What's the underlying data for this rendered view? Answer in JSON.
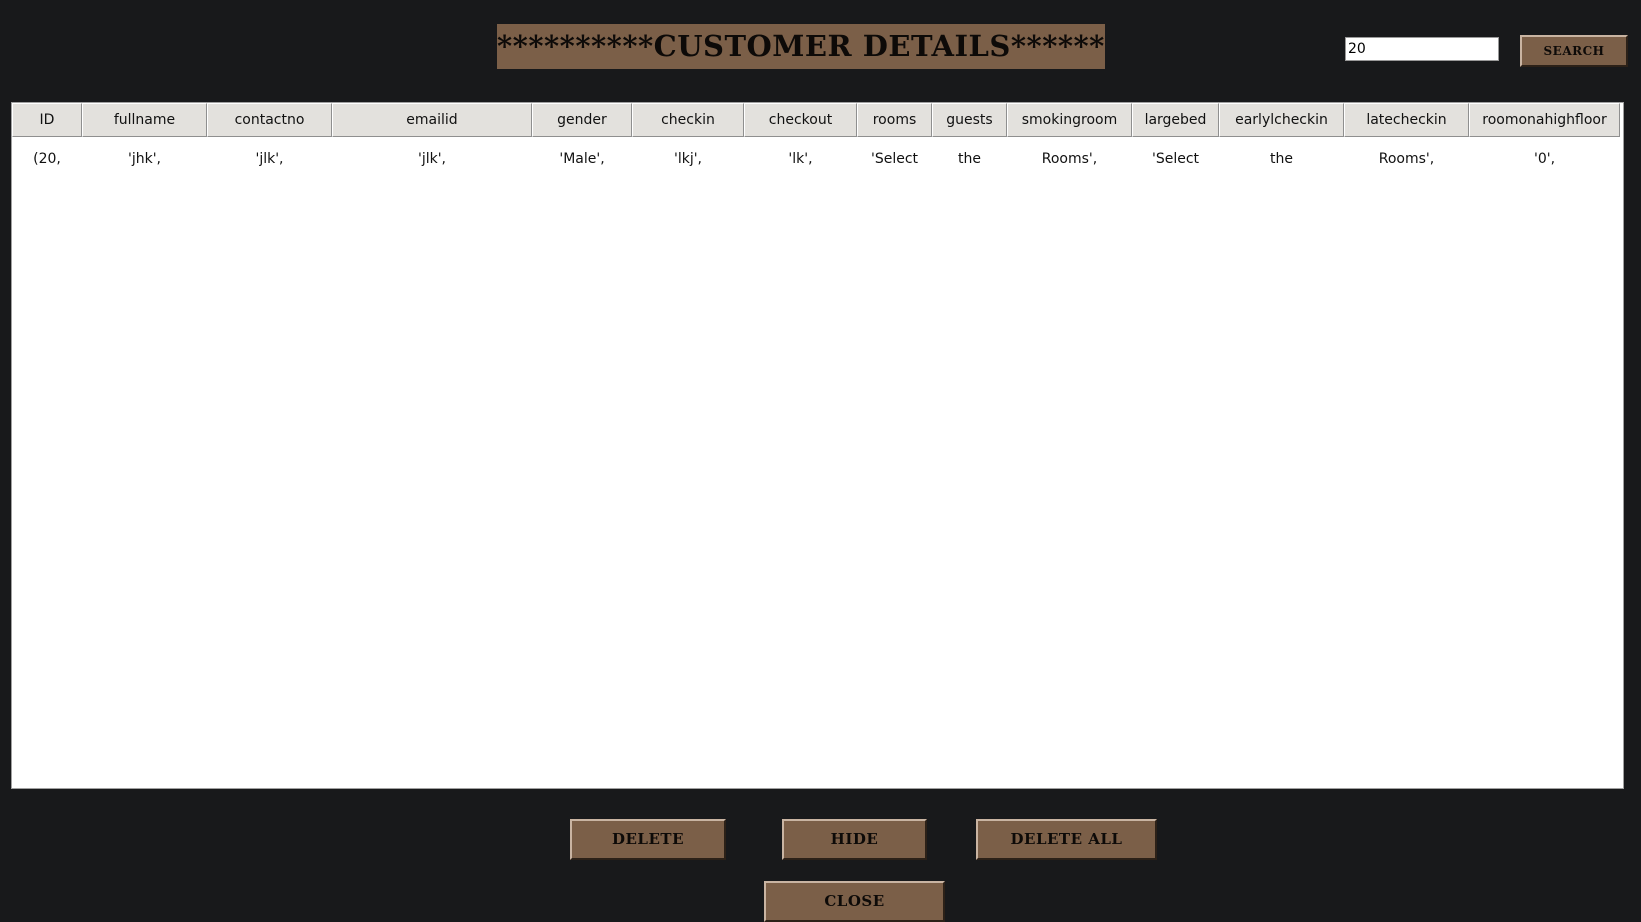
{
  "title": "**********CUSTOMER DETAILS**********",
  "search": {
    "value": "20",
    "button_label": "SEARCH"
  },
  "table": {
    "columns": [
      "ID",
      "fullname",
      "contactno",
      "emailid",
      "gender",
      "checkin",
      "checkout",
      "rooms",
      "guests",
      "smokingroom",
      "largebed",
      "earlylcheckin",
      "latecheckin",
      "roomonahighfloor"
    ],
    "rows": [
      [
        "(20,",
        "'jhk',",
        "'jlk',",
        "'jlk',",
        "'Male',",
        "'lkj',",
        "'lk',",
        "'Select",
        "the",
        "Rooms',",
        "'Select",
        "the",
        "Rooms',",
        "'0',"
      ]
    ]
  },
  "buttons": {
    "delete": "DELETE",
    "hide": "HIDE",
    "delete_all": "DELETE ALL",
    "close": "CLOSE"
  },
  "colors": {
    "background": "#18191b",
    "button": "#7b5f48",
    "table_background": "#ffffff",
    "header_background": "#e3e1dd"
  }
}
